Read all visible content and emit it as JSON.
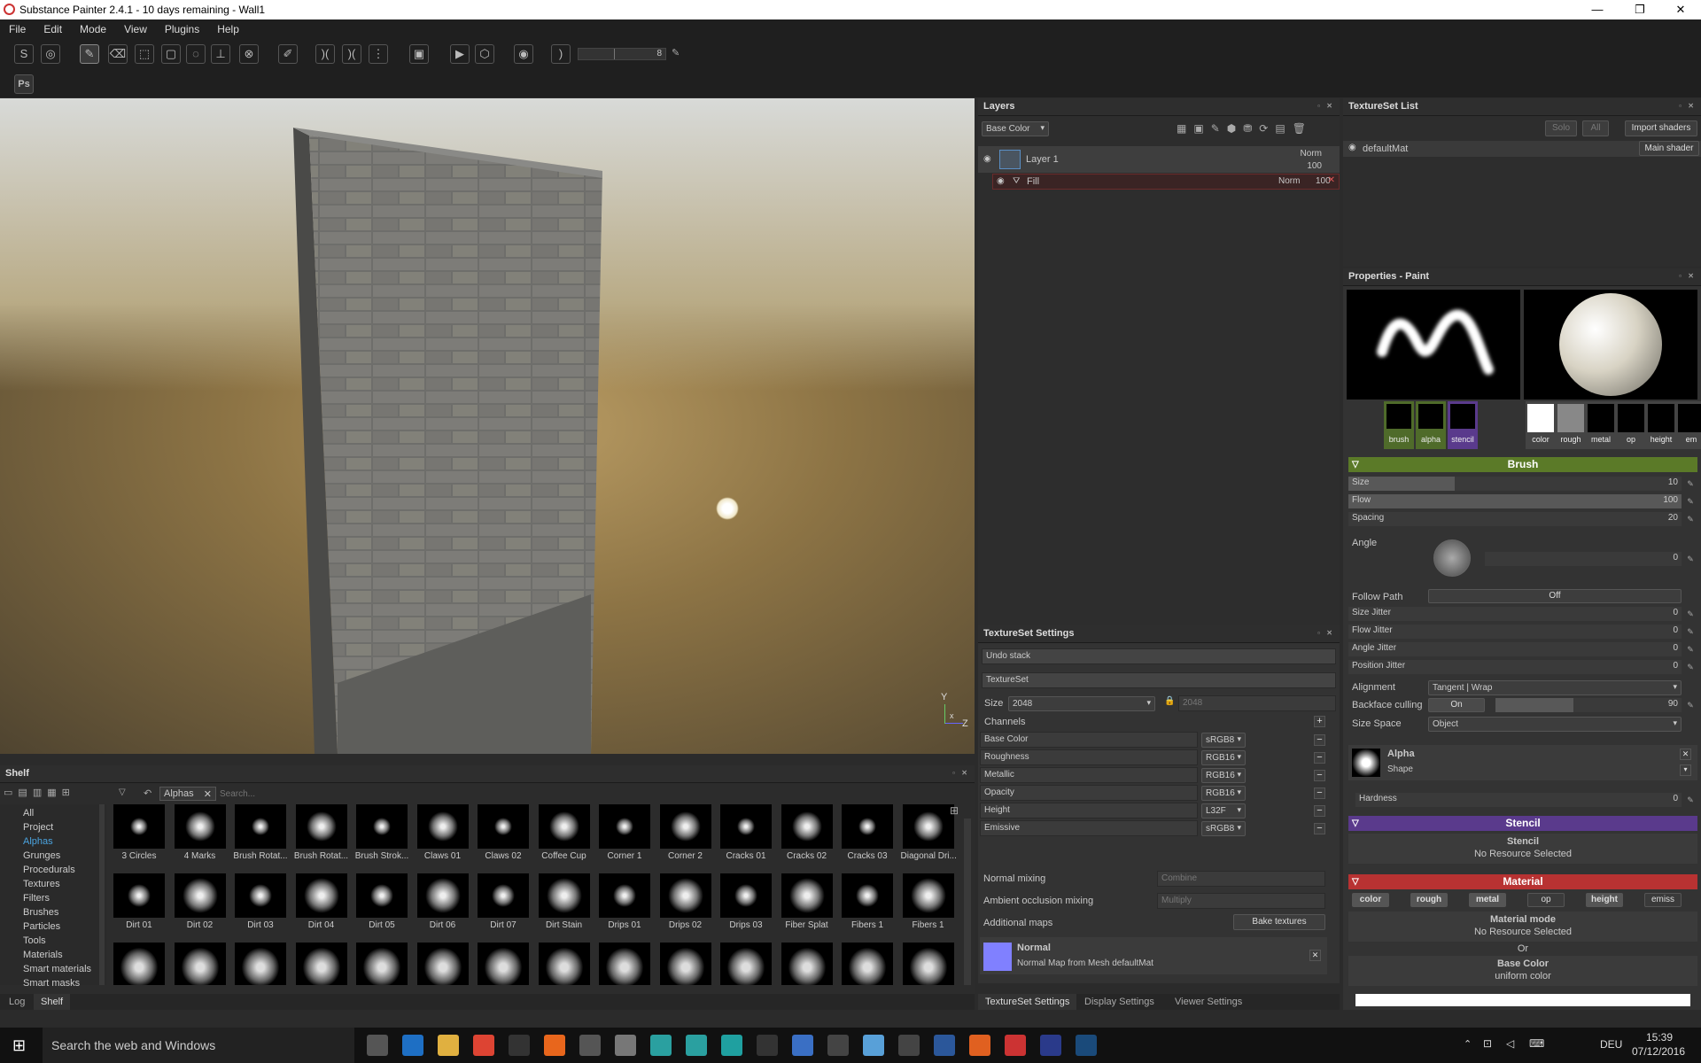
{
  "titlebar": {
    "title": "Substance Painter 2.4.1 - 10 days remaining - Wall1",
    "minimize": "—",
    "maximize": "❐",
    "close": "✕"
  },
  "menu": [
    "File",
    "Edit",
    "Mode",
    "View",
    "Plugins",
    "Help"
  ],
  "toolbar": {
    "slider_value": "8",
    "ps_label": "Ps"
  },
  "viewport": {
    "axis_y": "Y",
    "axis_z": "Z",
    "axis_x": "x"
  },
  "layers": {
    "title": "Layers",
    "channel": "Base Color",
    "layer1": {
      "name": "Layer 1",
      "blend": "Norm",
      "opacity": "100"
    },
    "fill": {
      "name": "Fill",
      "blend": "Norm",
      "opacity": "100"
    }
  },
  "textureset_list": {
    "title": "TextureSet List",
    "solo": "Solo",
    "all": "All",
    "import": "Import shaders",
    "material": "defaultMat",
    "shader": "Main shader"
  },
  "properties": {
    "title": "Properties - Paint",
    "tiles_left": [
      "brush",
      "alpha",
      "stencil"
    ],
    "tiles_right": [
      "color",
      "rough",
      "metal",
      "op",
      "height",
      "em"
    ],
    "brush_header": "Brush",
    "size": {
      "label": "Size",
      "value": "10",
      "fraction": 0.32
    },
    "flow": {
      "label": "Flow",
      "value": "100",
      "fraction": 1.0
    },
    "spacing": {
      "label": "Spacing",
      "value": "20",
      "fraction": 0.0
    },
    "angle": {
      "label": "Angle",
      "value": "0"
    },
    "follow_path": {
      "label": "Follow Path",
      "value": "Off"
    },
    "jitters": [
      {
        "label": "Size Jitter",
        "value": "0"
      },
      {
        "label": "Flow Jitter",
        "value": "0"
      },
      {
        "label": "Angle Jitter",
        "value": "0"
      },
      {
        "label": "Position Jitter",
        "value": "0"
      }
    ],
    "alignment": {
      "label": "Alignment",
      "value": "Tangent | Wrap"
    },
    "backface": {
      "label": "Backface culling",
      "state": "On",
      "value": "90"
    },
    "size_space": {
      "label": "Size Space",
      "value": "Object"
    },
    "alpha": {
      "title": "Alpha",
      "sub": "Shape"
    },
    "hardness": {
      "label": "Hardness",
      "value": "0"
    },
    "stencil_header": "Stencil",
    "stencil": {
      "title": "Stencil",
      "sub": "No Resource Selected"
    },
    "material_header": "Material",
    "material_chips": [
      "color",
      "rough",
      "metal",
      "op",
      "height",
      "emiss"
    ],
    "material_mode": {
      "title": "Material mode",
      "sub": "No Resource Selected",
      "or": "Or"
    },
    "base_color": {
      "title": "Base Color",
      "sub": "uniform color"
    }
  },
  "textureset_settings": {
    "title": "TextureSet Settings",
    "undo": "Undo stack",
    "textureset": "TextureSet",
    "size_label": "Size",
    "size": "2048",
    "size2": "2048",
    "channels": "Channels",
    "channel_rows": [
      {
        "name": "Base Color",
        "fmt": "sRGB8"
      },
      {
        "name": "Roughness",
        "fmt": "RGB16"
      },
      {
        "name": "Metallic",
        "fmt": "RGB16"
      },
      {
        "name": "Opacity",
        "fmt": "RGB16"
      },
      {
        "name": "Height",
        "fmt": "L32F"
      },
      {
        "name": "Emissive",
        "fmt": "sRGB8"
      }
    ],
    "normal_mixing": {
      "label": "Normal mixing",
      "value": "Combine"
    },
    "ao_mixing": {
      "label": "Ambient occlusion mixing",
      "value": "Multiply"
    },
    "additional": "Additional maps",
    "bake": "Bake textures",
    "normal": {
      "title": "Normal",
      "sub": "Normal Map from Mesh defaultMat"
    }
  },
  "tabs": [
    "TextureSet Settings",
    "Display Settings",
    "Viewer Settings"
  ],
  "shelf": {
    "title": "Shelf",
    "filter": "Alphas",
    "search_placeholder": "Search...",
    "categories": [
      "All",
      "Project",
      "Alphas",
      "Grunges",
      "Procedurals",
      "Textures",
      "Filters",
      "Brushes",
      "Particles",
      "Tools",
      "Materials",
      "Smart materials",
      "Smart masks"
    ],
    "row1": [
      "3 Circles",
      "4 Marks",
      "Brush Rotat...",
      "Brush Rotat...",
      "Brush Strok...",
      "Claws 01",
      "Claws 02",
      "Coffee Cup",
      "Corner 1",
      "Corner 2",
      "Cracks 01",
      "Cracks 02",
      "Cracks 03",
      "Diagonal Dri..."
    ],
    "row2": [
      "Dirt 01",
      "Dirt 02",
      "Dirt 03",
      "Dirt 04",
      "Dirt 05",
      "Dirt 06",
      "Dirt 07",
      "Dirt Stain",
      "Drips 01",
      "Drips 02",
      "Drips 03",
      "Fiber Splat",
      "Fibers 1",
      "Fibers 1"
    ]
  },
  "bottom_tabs": [
    "Log",
    "Shelf"
  ],
  "taskbar": {
    "search": "Search the web and Windows",
    "time": "15:39",
    "date": "07/12/2016",
    "lang": "DEU",
    "icons": [
      "task-view",
      "edge",
      "explorer",
      "chrome",
      "store",
      "firefox",
      "app7",
      "zbrush",
      "maya",
      "max",
      "3dsmax",
      "obs",
      "xnview",
      "epic",
      "aida",
      "unity",
      "word",
      "houdini",
      "substance",
      "photoshop",
      "steam"
    ]
  }
}
